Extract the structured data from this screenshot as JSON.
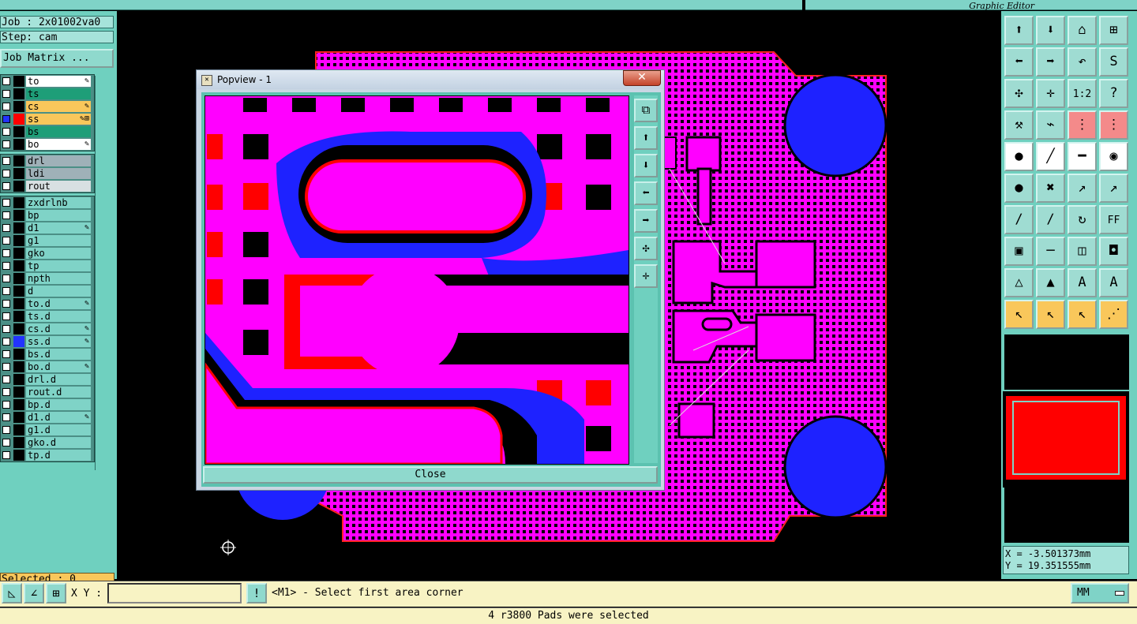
{
  "header": {
    "right_title": "Graphic Editor"
  },
  "left_panel": {
    "job": "Job : 2x01002va0",
    "step": "Step: cam",
    "job_matrix": "Job Matrix ...",
    "selected": "Selected : 0",
    "board_layers": [
      {
        "name": "to",
        "bg": "#ffffff",
        "color": "#000000",
        "mark": "✎"
      },
      {
        "name": "ts",
        "bg": "#1e9e78",
        "color": "#000000",
        "mark": ""
      },
      {
        "name": "cs",
        "bg": "#f9c75b",
        "color": "#000000",
        "mark": "✎"
      },
      {
        "name": "ss",
        "bg": "#f9c75b",
        "color": "#ff0000",
        "mark": "✎⊞",
        "active": true
      },
      {
        "name": "bs",
        "bg": "#1e9e78",
        "color": "#000000",
        "mark": ""
      },
      {
        "name": "bo",
        "bg": "#ffffff",
        "color": "#000000",
        "mark": "✎"
      }
    ],
    "drill_layers": [
      {
        "name": "drl",
        "bg": "#9fb1b8",
        "color": "#000000",
        "mark": ""
      },
      {
        "name": "ldi",
        "bg": "#9fb1b8",
        "color": "#000000",
        "mark": ""
      },
      {
        "name": "rout",
        "bg": "#d8e0e2",
        "color": "#000000",
        "mark": ""
      }
    ],
    "misc_layers": [
      {
        "name": "zxdrlnb",
        "bg": "#7fd3c7",
        "color": "#000000",
        "mark": ""
      },
      {
        "name": "bp",
        "bg": "#7fd3c7",
        "color": "#000000",
        "mark": ""
      },
      {
        "name": "d1",
        "bg": "#7fd3c7",
        "color": "#000000",
        "mark": "✎"
      },
      {
        "name": "g1",
        "bg": "#7fd3c7",
        "color": "#000000",
        "mark": ""
      },
      {
        "name": "gko",
        "bg": "#7fd3c7",
        "color": "#000000",
        "mark": ""
      },
      {
        "name": "tp",
        "bg": "#7fd3c7",
        "color": "#000000",
        "mark": ""
      },
      {
        "name": "npth",
        "bg": "#7fd3c7",
        "color": "#000000",
        "mark": ""
      },
      {
        "name": "d",
        "bg": "#7fd3c7",
        "color": "#000000",
        "mark": ""
      },
      {
        "name": "to.d",
        "bg": "#7fd3c7",
        "color": "#000000",
        "mark": "✎"
      },
      {
        "name": "ts.d",
        "bg": "#7fd3c7",
        "color": "#000000",
        "mark": ""
      },
      {
        "name": "cs.d",
        "bg": "#7fd3c7",
        "color": "#000000",
        "mark": "✎"
      },
      {
        "name": "ss.d",
        "bg": "#7fd3c7",
        "color": "#2233ff",
        "mark": "✎"
      },
      {
        "name": "bs.d",
        "bg": "#7fd3c7",
        "color": "#000000",
        "mark": ""
      },
      {
        "name": "bo.d",
        "bg": "#7fd3c7",
        "color": "#000000",
        "mark": "✎"
      },
      {
        "name": "drl.d",
        "bg": "#7fd3c7",
        "color": "#000000",
        "mark": ""
      },
      {
        "name": "rout.d",
        "bg": "#7fd3c7",
        "color": "#000000",
        "mark": ""
      },
      {
        "name": "bp.d",
        "bg": "#7fd3c7",
        "color": "#000000",
        "mark": ""
      },
      {
        "name": "d1.d",
        "bg": "#7fd3c7",
        "color": "#000000",
        "mark": "✎"
      },
      {
        "name": "g1.d",
        "bg": "#7fd3c7",
        "color": "#000000",
        "mark": ""
      },
      {
        "name": "gko.d",
        "bg": "#7fd3c7",
        "color": "#000000",
        "mark": ""
      },
      {
        "name": "tp.d",
        "bg": "#7fd3c7",
        "color": "#000000",
        "mark": ""
      }
    ]
  },
  "popview": {
    "title": "Popview - 1",
    "close_x": "✕",
    "close_label": "Close",
    "tools": [
      {
        "name": "popview-fit-icon",
        "glyph": "⧉"
      },
      {
        "name": "popview-up-icon",
        "glyph": "⬆"
      },
      {
        "name": "popview-down-icon",
        "glyph": "⬇"
      },
      {
        "name": "popview-left-icon",
        "glyph": "⬅"
      },
      {
        "name": "popview-right-icon",
        "glyph": "➡"
      },
      {
        "name": "popview-zoom-out-icon",
        "glyph": "✣"
      },
      {
        "name": "popview-zoom-in-icon",
        "glyph": "✛"
      }
    ]
  },
  "toolbar": {
    "buttons": [
      {
        "name": "pan-up-icon",
        "glyph": "⬆",
        "style": ""
      },
      {
        "name": "pan-down-icon",
        "glyph": "⬇",
        "style": ""
      },
      {
        "name": "home-icon",
        "glyph": "⌂",
        "style": ""
      },
      {
        "name": "window-zoom-icon",
        "glyph": "⊞",
        "style": ""
      },
      {
        "name": "pan-left-icon",
        "glyph": "⬅",
        "style": ""
      },
      {
        "name": "pan-right-icon",
        "glyph": "➡",
        "style": ""
      },
      {
        "name": "undo-view-icon",
        "glyph": "↶",
        "style": ""
      },
      {
        "name": "redraw-icon",
        "glyph": "S",
        "style": ""
      },
      {
        "name": "zoom-out-icon",
        "glyph": "✣",
        "style": ""
      },
      {
        "name": "zoom-in-icon",
        "glyph": "✛",
        "style": ""
      },
      {
        "name": "scale-1-2-icon",
        "glyph": "1:2",
        "style": ""
      },
      {
        "name": "help-icon",
        "glyph": "?",
        "style": ""
      },
      {
        "name": "measure-icon",
        "glyph": "⚒",
        "style": ""
      },
      {
        "name": "probe-icon",
        "glyph": "⌁",
        "style": ""
      },
      {
        "name": "net-highlight-icon",
        "glyph": "⋮",
        "style": "red"
      },
      {
        "name": "net-connect-icon",
        "glyph": "⋮",
        "style": "red"
      },
      {
        "name": "add-pad-icon",
        "glyph": "●",
        "style": "white"
      },
      {
        "name": "add-line-icon",
        "glyph": "╱",
        "style": "white"
      },
      {
        "name": "ruler-icon",
        "glyph": "━",
        "style": "white"
      },
      {
        "name": "select-pad-icon",
        "glyph": "◉",
        "style": "white"
      },
      {
        "name": "connect-nodes-icon",
        "glyph": "●",
        "style": ""
      },
      {
        "name": "delete-icon",
        "glyph": "✖",
        "style": ""
      },
      {
        "name": "move-line-icon",
        "glyph": "↗",
        "style": ""
      },
      {
        "name": "move-point-icon",
        "glyph": "↗",
        "style": ""
      },
      {
        "name": "edit-line-icon",
        "glyph": "∕",
        "style": ""
      },
      {
        "name": "slant-line-icon",
        "glyph": "∕",
        "style": ""
      },
      {
        "name": "arc-icon",
        "glyph": "↻",
        "style": ""
      },
      {
        "name": "mirror-icon",
        "glyph": "FF",
        "style": ""
      },
      {
        "name": "copy-pad-icon",
        "glyph": "▣",
        "style": ""
      },
      {
        "name": "line-width-icon",
        "glyph": "─",
        "style": ""
      },
      {
        "name": "pad-size-icon",
        "glyph": "◫",
        "style": ""
      },
      {
        "name": "group-icon",
        "glyph": "◘",
        "style": ""
      },
      {
        "name": "triangle-icon",
        "glyph": "△",
        "style": ""
      },
      {
        "name": "arch-icon",
        "glyph": "▲",
        "style": ""
      },
      {
        "name": "frame-icon",
        "glyph": "A",
        "style": ""
      },
      {
        "name": "shape-icon",
        "glyph": "A",
        "style": ""
      },
      {
        "name": "select-arrow-icon",
        "glyph": "↖",
        "style": "orange"
      },
      {
        "name": "select-box-icon",
        "glyph": "↖",
        "style": "orange"
      },
      {
        "name": "select-area-icon",
        "glyph": "↖",
        "style": "orange"
      },
      {
        "name": "select-net-icon",
        "glyph": "⋰",
        "style": "orange"
      }
    ]
  },
  "coords": {
    "x": "X = -3.501373mm",
    "y": "Y = 19.351555mm"
  },
  "bottom": {
    "xy_label": "X Y :",
    "xy_value": "",
    "prompt": "<M1> - Select first area corner",
    "units": "MM",
    "status": "4 r3800 Pads were selected"
  }
}
